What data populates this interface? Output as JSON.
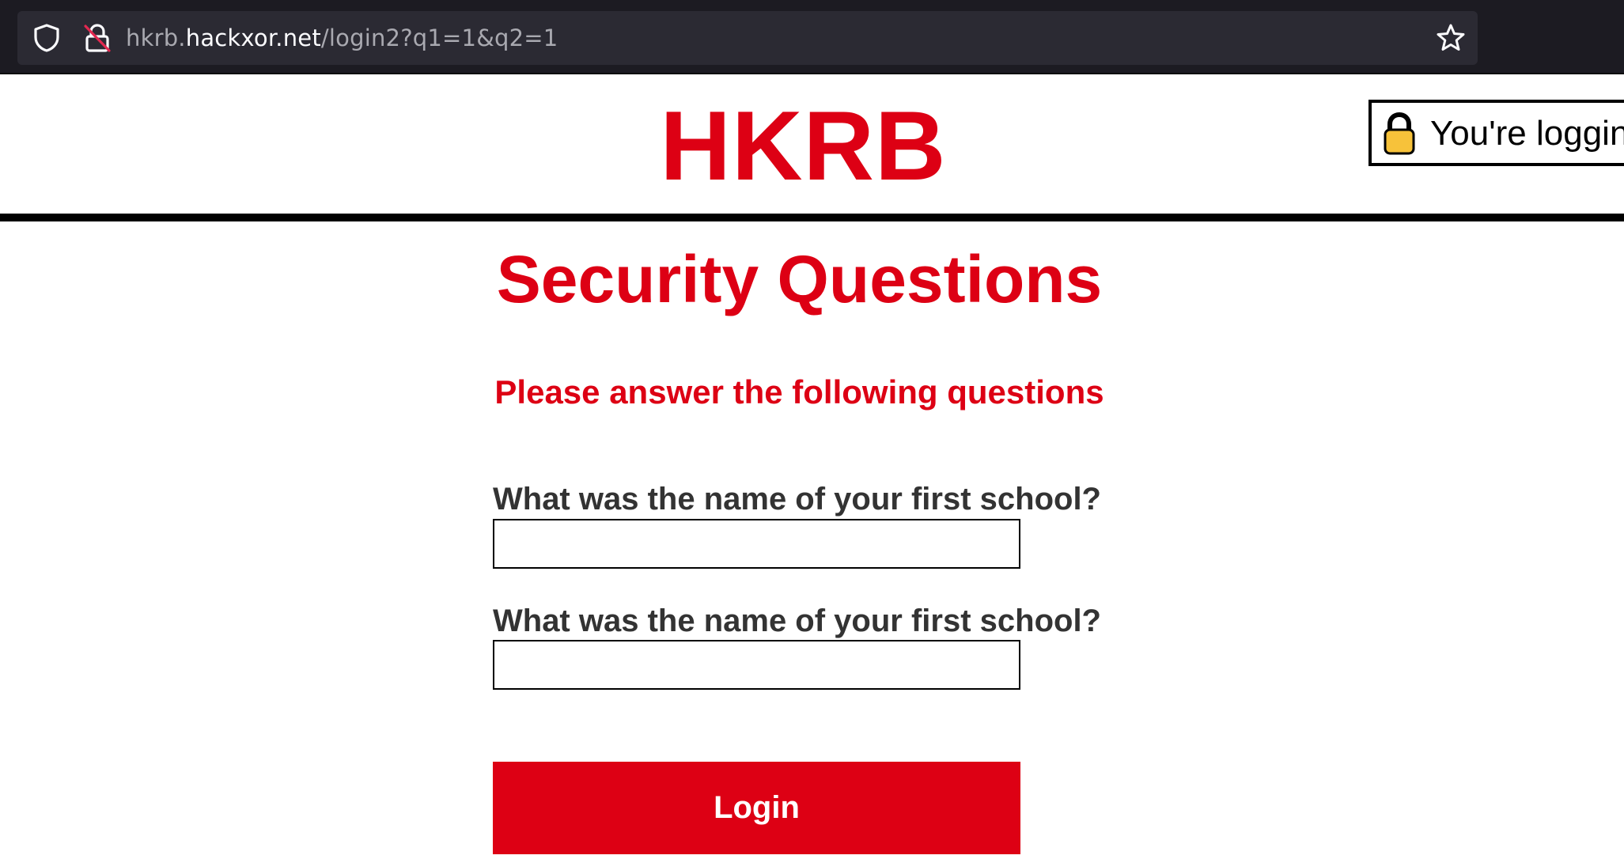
{
  "browser": {
    "url_prefix": "hkrb.",
    "url_host": "hackxor.net",
    "url_path": "/login2?q1=1&q2=1",
    "icons": [
      "shield-icon",
      "lock-strike-icon",
      "star-icon"
    ]
  },
  "header": {
    "logo": "HKRB",
    "secure_notice": "You're logging",
    "secure_icon": "padlock-icon"
  },
  "main": {
    "title": "Security Questions",
    "subtitle": "Please answer the following questions",
    "questions": [
      {
        "label": "What was the name of your first school?",
        "value": ""
      },
      {
        "label": "What was the name of your first school?",
        "value": ""
      }
    ],
    "login_label": "Login"
  },
  "colors": {
    "brand_red": "#dd0014",
    "question_text": "#333333",
    "browser_bar": "#1c1b22",
    "url_field": "#2b2a33"
  }
}
